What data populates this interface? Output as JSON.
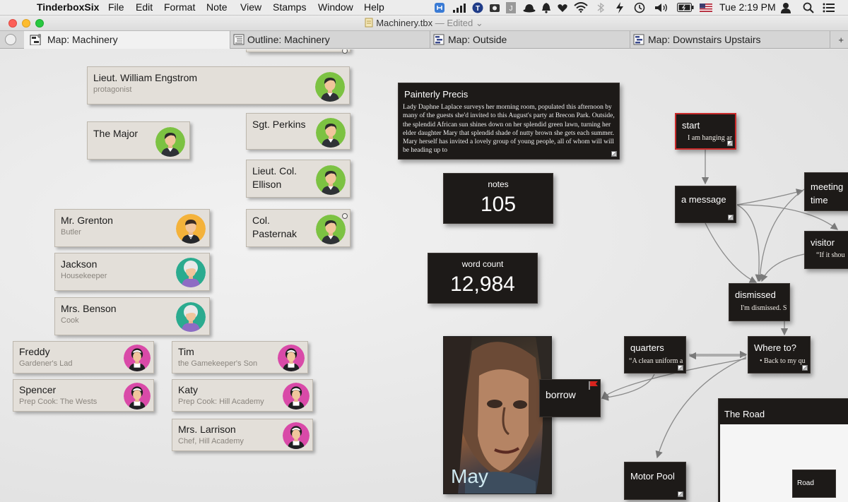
{
  "menubar": {
    "app_name": "TinderboxSix",
    "items": [
      "File",
      "Edit",
      "Format",
      "Note",
      "View",
      "Stamps",
      "Window",
      "Help"
    ],
    "clock": "Tue 2:19 PM"
  },
  "window": {
    "title": "Machinery.tbx",
    "edited": "— Edited"
  },
  "tabs": [
    {
      "label": "Map: Machinery",
      "active": true
    },
    {
      "label": "Outline: Machinery",
      "active": false
    },
    {
      "label": "Map: Outside",
      "active": false
    },
    {
      "label": "Map: Downstairs Upstairs",
      "active": false
    }
  ],
  "tab_plus": "+",
  "people": [
    {
      "name": "Lieut. William Engstrom",
      "subtitle": "protagonist",
      "avatar": "green-man-avatar"
    },
    {
      "name": "The Major",
      "subtitle": "",
      "avatar": "green-man-avatar"
    },
    {
      "name": "Sgt. Perkins",
      "subtitle": "",
      "avatar": "green-man-avatar"
    },
    {
      "name": "Lieut. Col.\nEllison",
      "subtitle": "",
      "avatar": "green-man-avatar"
    },
    {
      "name": "Col.\nPasternak",
      "subtitle": "",
      "avatar": "green-man-avatar"
    },
    {
      "name": "Mr. Grenton",
      "subtitle": "Butler",
      "avatar": "butler-avatar"
    },
    {
      "name": "Jackson",
      "subtitle": "Housekeeper",
      "avatar": "elderly-woman-avatar"
    },
    {
      "name": "Mrs. Benson",
      "subtitle": "Cook",
      "avatar": "elderly-woman-avatar"
    },
    {
      "name": "Freddy",
      "subtitle": "Gardener's Lad",
      "avatar": "maid-avatar"
    },
    {
      "name": "Tim",
      "subtitle": "the Gamekeeper's Son",
      "avatar": "maid-avatar"
    },
    {
      "name": "Spencer",
      "subtitle": "Prep Cook: The Wests",
      "avatar": "maid-avatar"
    },
    {
      "name": "Katy",
      "subtitle": "Prep Cook: Hill Academy",
      "avatar": "maid-avatar"
    },
    {
      "name": "Mrs. Larrison",
      "subtitle": "Chef, Hill Academy",
      "avatar": "maid-avatar"
    }
  ],
  "precis": {
    "title": "Painterly Precis",
    "body": "Lady Daphne Laplace surveys her morning room, populated this afternoon by many of the guests she'd invited to this August's party at Brecon Park. Outside, the splendid African sun shines down on her splendid green lawn, turning her elder daughter Mary that splendid shade of nutty brown she gets each summer. Mary herself has invited a lovely group of young people, all of whom will will be heading up to"
  },
  "stats": [
    {
      "label": "notes",
      "value": "105"
    },
    {
      "label": "word count",
      "value": "12,984"
    }
  ],
  "story": {
    "start": {
      "title": "start",
      "text": "I am hanging ar"
    },
    "message": {
      "title": "a message"
    },
    "meeting": {
      "title": "meeting time"
    },
    "visitor": {
      "title": "visitor",
      "text": "“If it shou"
    },
    "dismissed": {
      "title": "dismissed",
      "text": "I'm dismissed. S"
    },
    "whereto": {
      "title": "Where to?",
      "text": "• Back to my qu"
    },
    "quarters": {
      "title": "quarters",
      "text": "“A clean uniform a"
    },
    "borrow": {
      "title": "borrow"
    },
    "motorpool": {
      "title": "Motor Pool"
    },
    "road": {
      "title": "The Road",
      "inner": "Road"
    }
  },
  "portrait": {
    "caption": "May"
  }
}
